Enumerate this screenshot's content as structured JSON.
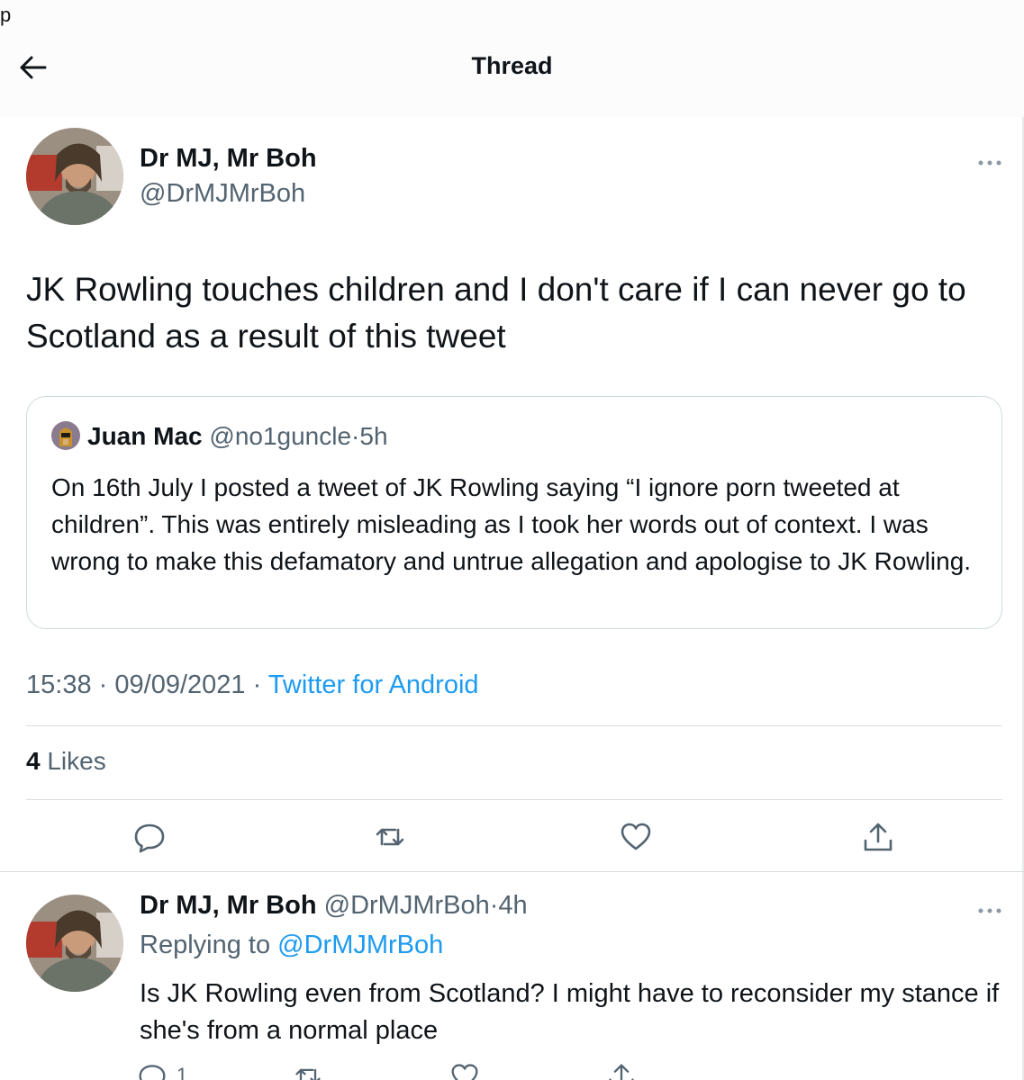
{
  "header": {
    "corner_glyph": "p",
    "back_label": "Back",
    "title": "Thread"
  },
  "main_tweet": {
    "author": "Dr MJ, Mr Boh",
    "handle": "@DrMJMrBoh",
    "text": "JK Rowling touches children and I don't care if I can never go to Scotland as a result of this tweet",
    "quote": {
      "author": "Juan Mac",
      "handle": "@no1guncle",
      "separator": "·",
      "time": "5h",
      "text": "On 16th July I posted a tweet of JK Rowling saying “I ignore porn tweeted at children”. This was entirely misleading as I took her words out of context. I was wrong to make this defamatory and untrue allegation and apologise to JK Rowling."
    },
    "time": "15:38",
    "date": "09/09/2021",
    "separator": "·",
    "source": "Twitter for Android",
    "likes_count": "4",
    "likes_label": "Likes"
  },
  "reply_tweet": {
    "author": "Dr MJ, Mr Boh",
    "handle": "@DrMJMrBoh",
    "separator": "·",
    "time": "4h",
    "replying_prefix": "Replying to",
    "replying_handle": "@DrMJMrBoh",
    "text": "Is JK Rowling even from Scotland? I might have to reconsider my stance if she's from a normal place",
    "reply_count": "1"
  },
  "icons": {
    "back": "arrow-left-icon",
    "more": "more-horizontal-icon",
    "reply": "speech-bubble-icon",
    "retweet": "retweet-icon",
    "like": "heart-icon",
    "share": "share-upload-icon"
  },
  "colors": {
    "link": "#1d9bf0",
    "muted": "#536471",
    "text": "#0f1419",
    "divider": "#cfd9de"
  }
}
